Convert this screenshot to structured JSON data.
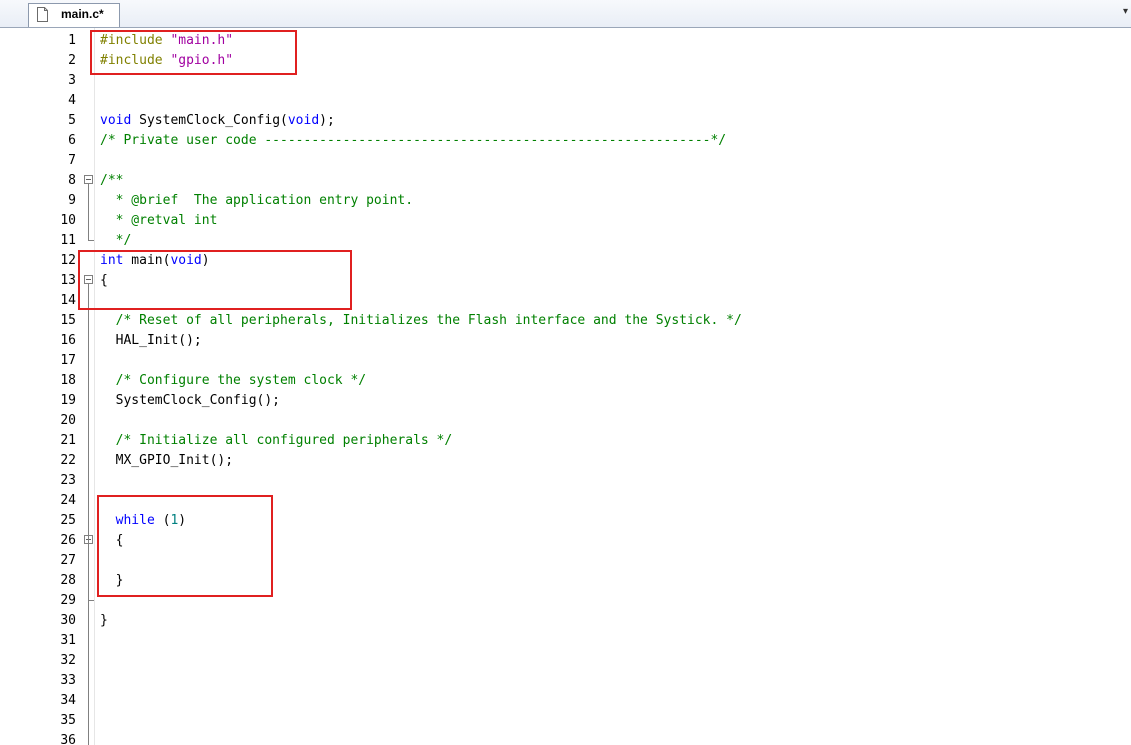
{
  "tab": {
    "filename": "main.c*",
    "menu_glyph": "▾"
  },
  "icons": {
    "file": "file-icon",
    "dropdown": "chevron-down-icon",
    "fold": "fold-minus-icon"
  },
  "colors": {
    "keyword": "#0000ff",
    "preprocessor": "#808000",
    "string": "#a000a0",
    "comment": "#008000",
    "number": "#008080",
    "highlight_box": "#e02020"
  },
  "lines": [
    {
      "n": "1",
      "segs": [
        [
          "pp",
          "#include "
        ],
        [
          "str",
          "\"main.h\""
        ]
      ]
    },
    {
      "n": "2",
      "segs": [
        [
          "pp",
          "#include "
        ],
        [
          "str",
          "\"gpio.h\""
        ]
      ]
    },
    {
      "n": "3",
      "segs": []
    },
    {
      "n": "4",
      "segs": []
    },
    {
      "n": "5",
      "segs": [
        [
          "kw",
          "void"
        ],
        [
          "",
          " SystemClock_Config("
        ],
        [
          "kw",
          "void"
        ],
        [
          "",
          ");"
        ]
      ]
    },
    {
      "n": "6",
      "segs": [
        [
          "cm",
          "/* Private user code ---------------------------------------------------------*/"
        ]
      ]
    },
    {
      "n": "7",
      "segs": []
    },
    {
      "n": "8",
      "segs": [
        [
          "cm",
          "/**"
        ]
      ],
      "fold": true
    },
    {
      "n": "9",
      "segs": [
        [
          "cm",
          "  * @brief  The application entry point."
        ]
      ]
    },
    {
      "n": "10",
      "segs": [
        [
          "cm",
          "  * @retval int"
        ]
      ]
    },
    {
      "n": "11",
      "segs": [
        [
          "cm",
          "  */"
        ]
      ]
    },
    {
      "n": "12",
      "segs": [
        [
          "kw",
          "int"
        ],
        [
          "",
          " main("
        ],
        [
          "kw",
          "void"
        ],
        [
          "",
          ")"
        ]
      ]
    },
    {
      "n": "13",
      "segs": [
        [
          "",
          "{"
        ]
      ],
      "fold": true
    },
    {
      "n": "14",
      "segs": []
    },
    {
      "n": "15",
      "segs": [
        [
          "cm",
          "  /* Reset of all peripherals, Initializes the Flash interface and the Systick. */"
        ]
      ]
    },
    {
      "n": "16",
      "segs": [
        [
          "",
          "  HAL_Init();"
        ]
      ]
    },
    {
      "n": "17",
      "segs": []
    },
    {
      "n": "18",
      "segs": [
        [
          "cm",
          "  /* Configure the system clock */"
        ]
      ]
    },
    {
      "n": "19",
      "segs": [
        [
          "",
          "  SystemClock_Config();"
        ]
      ]
    },
    {
      "n": "20",
      "segs": []
    },
    {
      "n": "21",
      "segs": [
        [
          "cm",
          "  /* Initialize all configured peripherals */"
        ]
      ]
    },
    {
      "n": "22",
      "segs": [
        [
          "",
          "  MX_GPIO_Init();"
        ]
      ]
    },
    {
      "n": "23",
      "segs": []
    },
    {
      "n": "24",
      "segs": []
    },
    {
      "n": "25",
      "segs": [
        [
          "",
          "  "
        ],
        [
          "kw",
          "while"
        ],
        [
          "",
          " ("
        ],
        [
          "num",
          "1"
        ],
        [
          "",
          ")"
        ]
      ]
    },
    {
      "n": "26",
      "segs": [
        [
          "",
          "  {"
        ]
      ],
      "fold": true
    },
    {
      "n": "27",
      "segs": []
    },
    {
      "n": "28",
      "segs": [
        [
          "",
          "  }"
        ]
      ]
    },
    {
      "n": "29",
      "segs": []
    },
    {
      "n": "30",
      "segs": [
        [
          "",
          "}"
        ]
      ]
    },
    {
      "n": "31",
      "segs": []
    },
    {
      "n": "32",
      "segs": []
    },
    {
      "n": "33",
      "segs": []
    },
    {
      "n": "34",
      "segs": []
    },
    {
      "n": "35",
      "segs": []
    },
    {
      "n": "36",
      "segs": []
    }
  ]
}
